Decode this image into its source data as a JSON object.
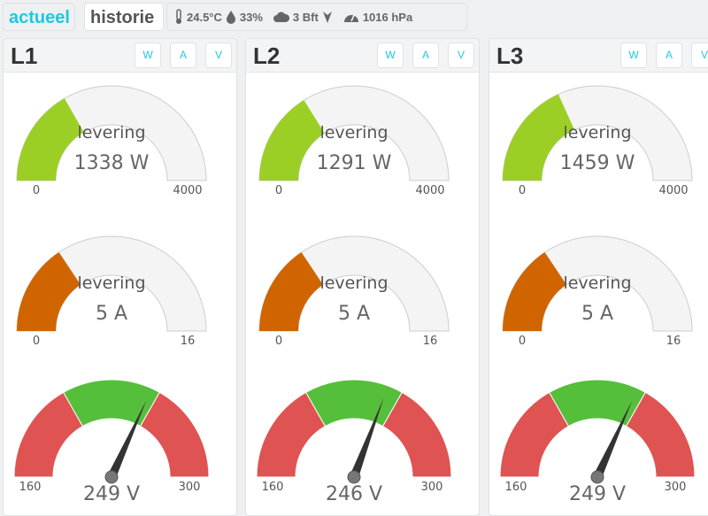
{
  "tabs": [
    {
      "label": "actueel",
      "active": true
    },
    {
      "label": "historie",
      "active": false
    }
  ],
  "weather": {
    "temperature": "24.5°C",
    "humidity": "33%",
    "wind": "3 Bft",
    "pressure": "1016 hPa",
    "icons": [
      "thermometer-icon",
      "humidity-drop-icon",
      "cloud-wind-icon",
      "wind-direction-arrow-icon",
      "gauge-icon"
    ]
  },
  "buttons": [
    "W",
    "A",
    "V"
  ],
  "colors": {
    "accent": "#1ec8e0",
    "power": "#9ccf26",
    "current": "#d06500",
    "voltage_ok": "#55bf3b",
    "voltage_bad": "#df5353",
    "gauge_bg": "#f4f4f4"
  },
  "phases": [
    {
      "name": "L1",
      "power": {
        "label": "levering",
        "value": 1338,
        "unit": "W",
        "display": "1338 W",
        "min": "0",
        "max": "4000"
      },
      "current": {
        "label": "levering",
        "value": 5,
        "unit": "A",
        "display": "5 A",
        "min": "0",
        "max": "16"
      },
      "voltage": {
        "value": 249,
        "display": "249 V",
        "min": "160",
        "max": "300"
      }
    },
    {
      "name": "L2",
      "power": {
        "label": "levering",
        "value": 1291,
        "unit": "W",
        "display": "1291 W",
        "min": "0",
        "max": "4000"
      },
      "current": {
        "label": "levering",
        "value": 5,
        "unit": "A",
        "display": "5 A",
        "min": "0",
        "max": "16"
      },
      "voltage": {
        "value": 246,
        "display": "246 V",
        "min": "160",
        "max": "300"
      }
    },
    {
      "name": "L3",
      "power": {
        "label": "levering",
        "value": 1459,
        "unit": "W",
        "display": "1459 W",
        "min": "0",
        "max": "4000"
      },
      "current": {
        "label": "levering",
        "value": 5,
        "unit": "A",
        "display": "5 A",
        "min": "0",
        "max": "16"
      },
      "voltage": {
        "value": 249,
        "display": "249 V",
        "min": "160",
        "max": "300"
      }
    }
  ],
  "voltage_bands": [
    [
      160,
      207,
      "bad"
    ],
    [
      207,
      253,
      "ok"
    ],
    [
      253,
      300,
      "bad"
    ]
  ]
}
